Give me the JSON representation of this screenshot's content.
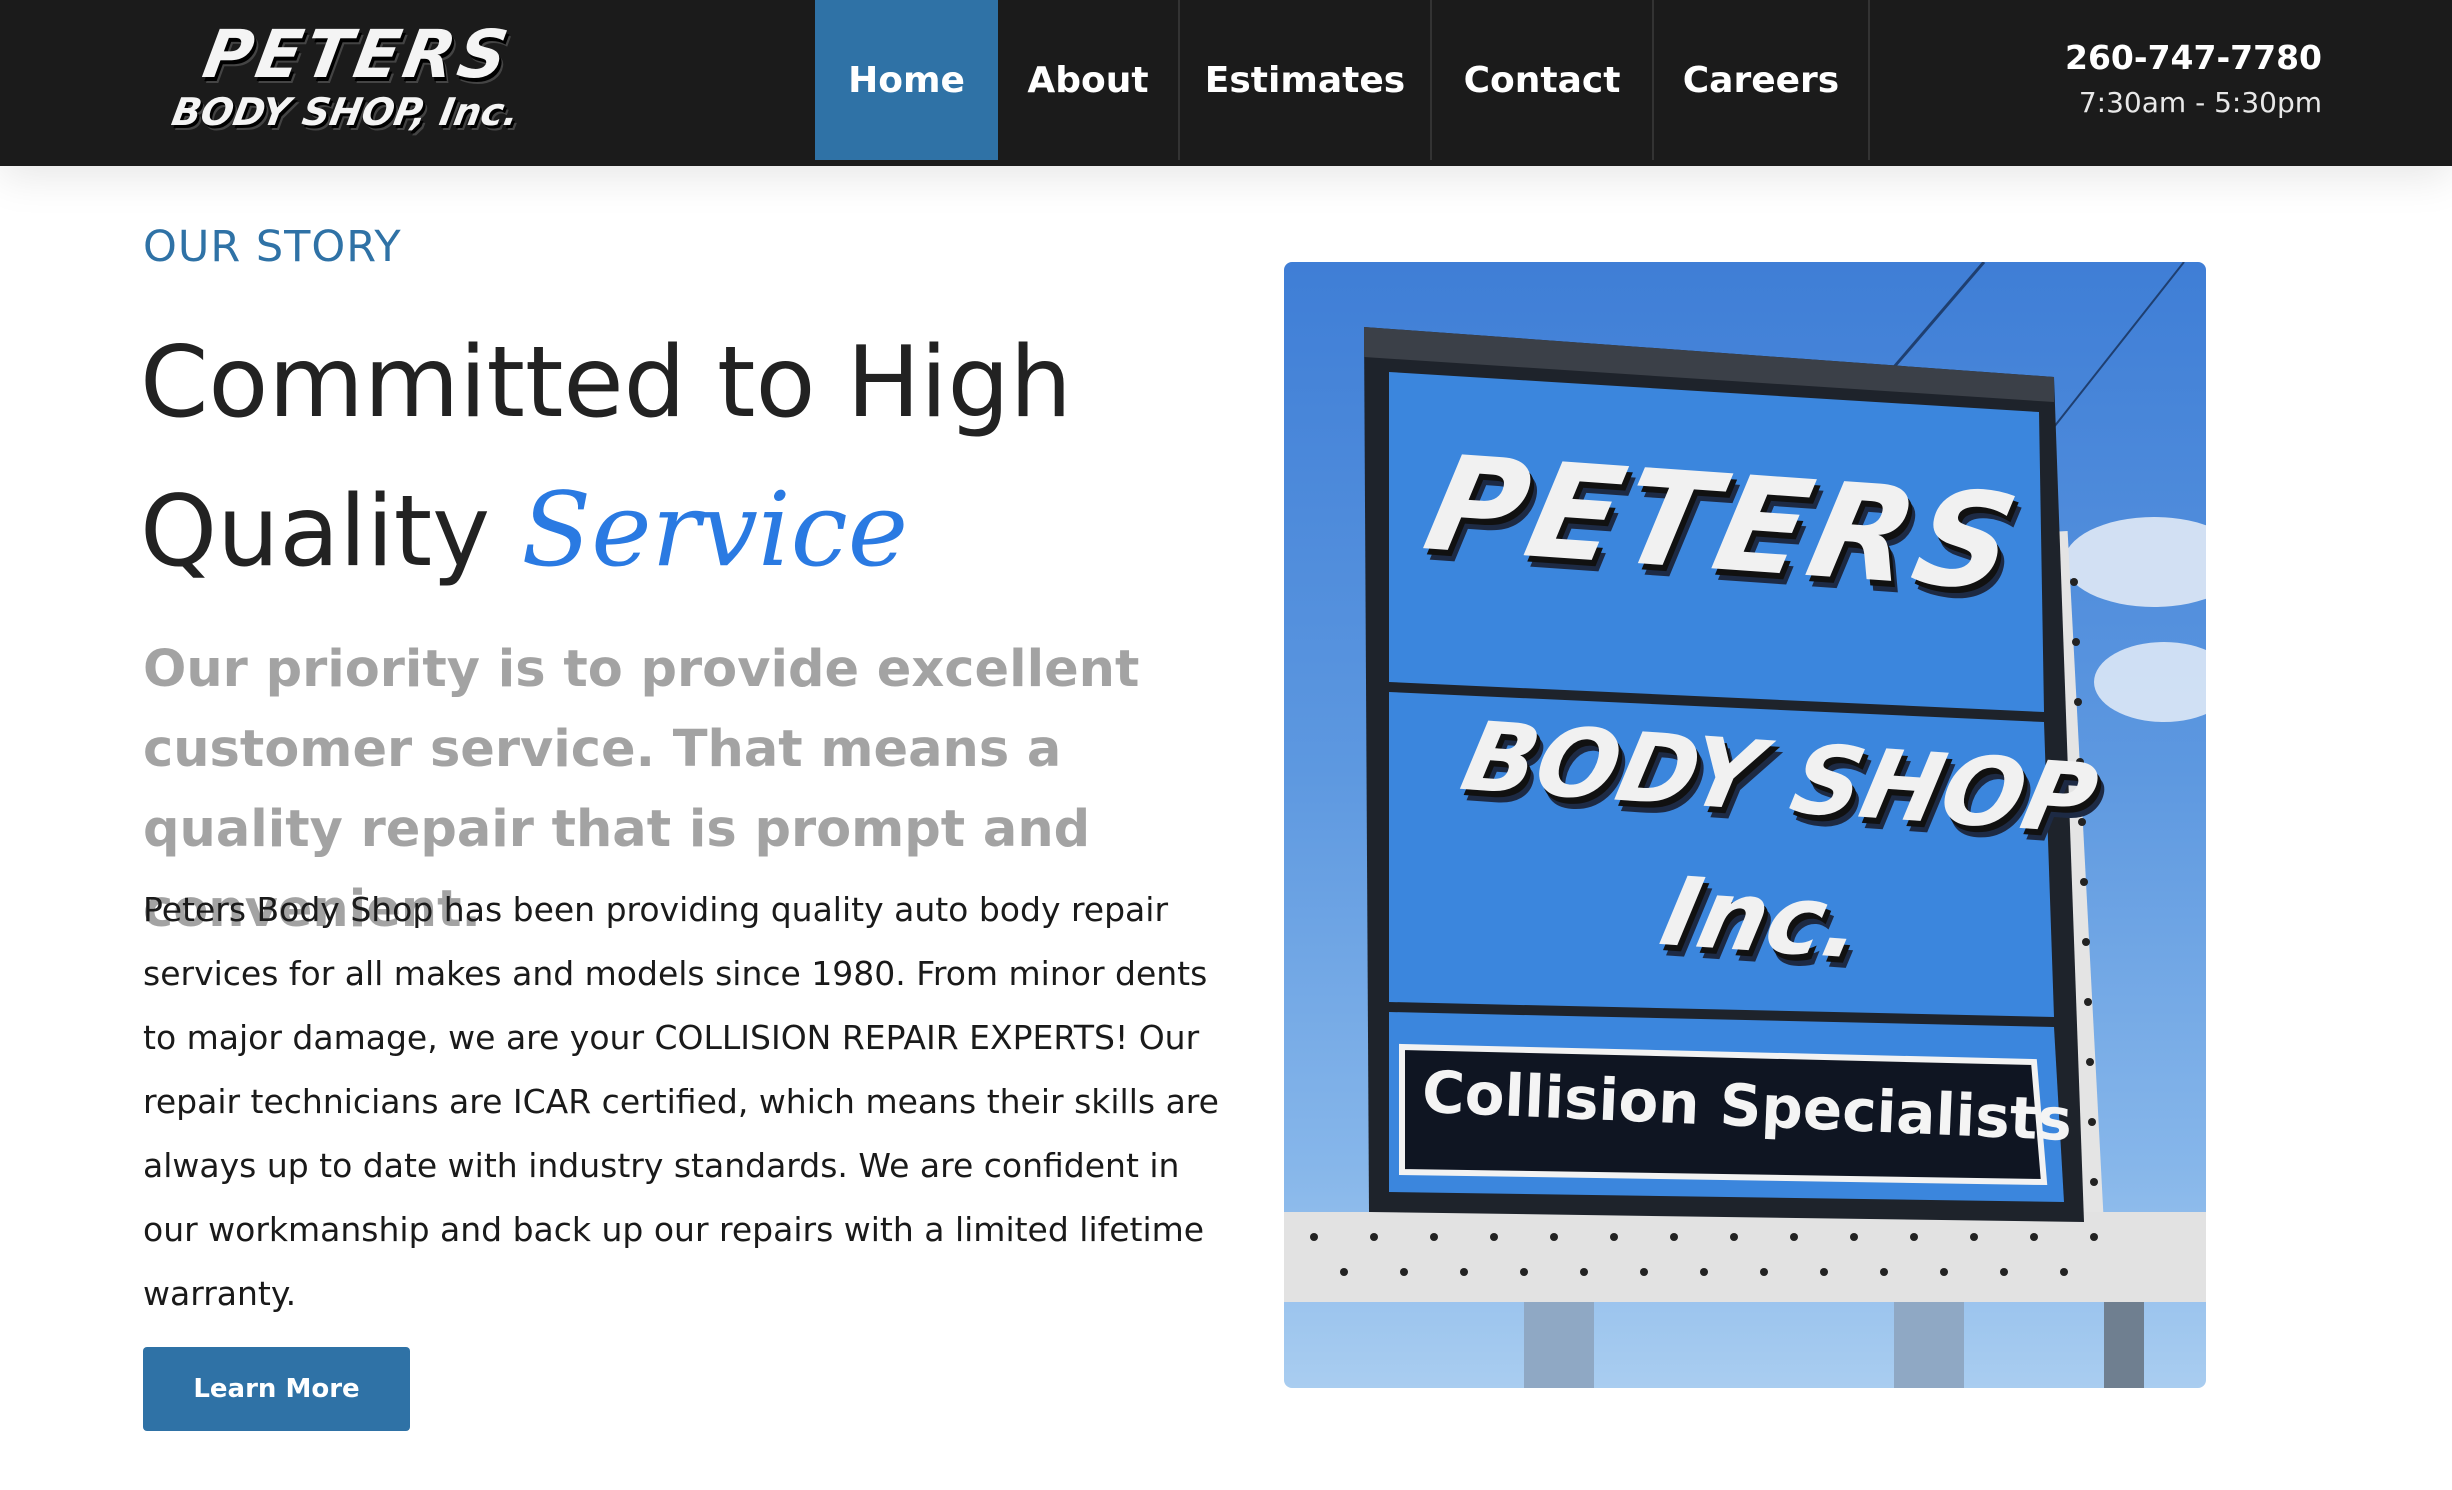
{
  "header": {
    "logo_line1": "PETERS",
    "logo_line2": "BODY SHOP, Inc.",
    "nav": [
      {
        "label": "Home",
        "active": true
      },
      {
        "label": "About",
        "active": false
      },
      {
        "label": "Estimates",
        "active": false
      },
      {
        "label": "Contact",
        "active": false
      },
      {
        "label": "Careers",
        "active": false
      }
    ],
    "phone": "260-747-7780",
    "hours": "7:30am - 5:30pm"
  },
  "story": {
    "eyebrow": "OUR STORY",
    "headline_main": "Committed to High Quality ",
    "headline_accent": "Service",
    "lead": "Our priority is to provide excellent customer service. That means a quality repair that is prompt and convenient.",
    "body": "Peters Body Shop has been providing quality auto body repair services for all makes and models since 1980. From minor dents to major damage, we are your COLLISION REPAIR EXPERTS! Our repair technicians are ICAR certified, which means their skills are always up to date with industry standards. We are confident in our workmanship and back up our repairs with a limited lifetime warranty.",
    "button_label": "Learn More"
  },
  "photo": {
    "sign_line1": "PETERS",
    "sign_line2": "BODY SHOP",
    "sign_line3": "Inc.",
    "sign_banner": "Collision Specialists"
  },
  "colors": {
    "header_bg": "#1b1b1b",
    "accent_blue": "#2f72a6",
    "service_blue": "#2a7ae2",
    "lead_gray": "#a3a3a3"
  }
}
